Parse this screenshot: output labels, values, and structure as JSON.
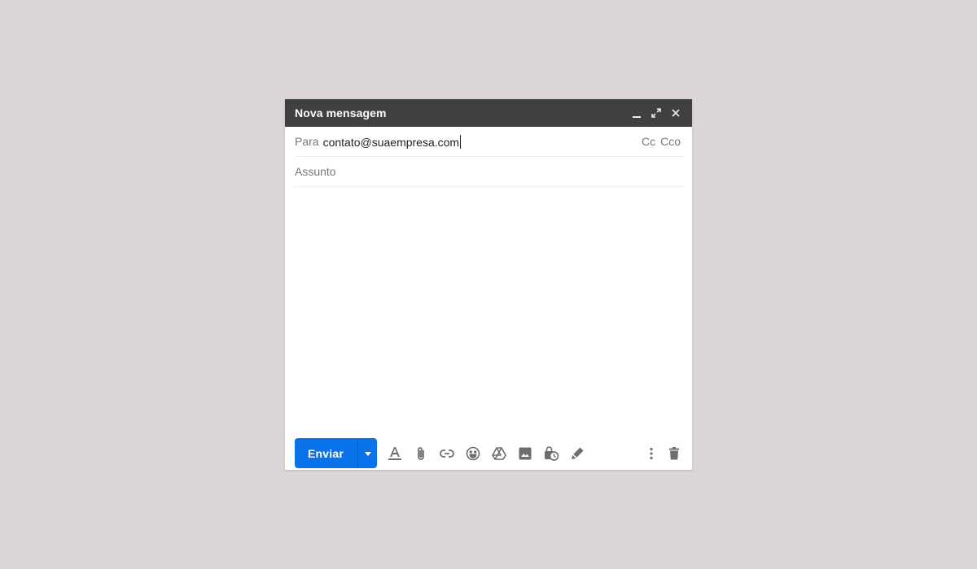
{
  "window": {
    "title": "Nova mensagem",
    "controls": [
      "minimize-icon",
      "expand-icon",
      "close-icon"
    ]
  },
  "to": {
    "label": "Para",
    "value": "contato@suaempresa.com",
    "cc": "Cc",
    "bcc": "Cco"
  },
  "subject": {
    "placeholder": "Assunto",
    "value": ""
  },
  "toolbar": {
    "send_label": "Enviar",
    "icons": [
      "format-text-icon",
      "attach-icon",
      "link-icon",
      "emoji-icon",
      "drive-icon",
      "photo-icon",
      "confidential-mode-icon",
      "signature-icon",
      "more-options-icon",
      "discard-icon"
    ]
  },
  "colors": {
    "background": "#dbd5d6",
    "titlebar": "#404040",
    "send_button": "#0b73e9",
    "icon": "#6e6e6e"
  }
}
